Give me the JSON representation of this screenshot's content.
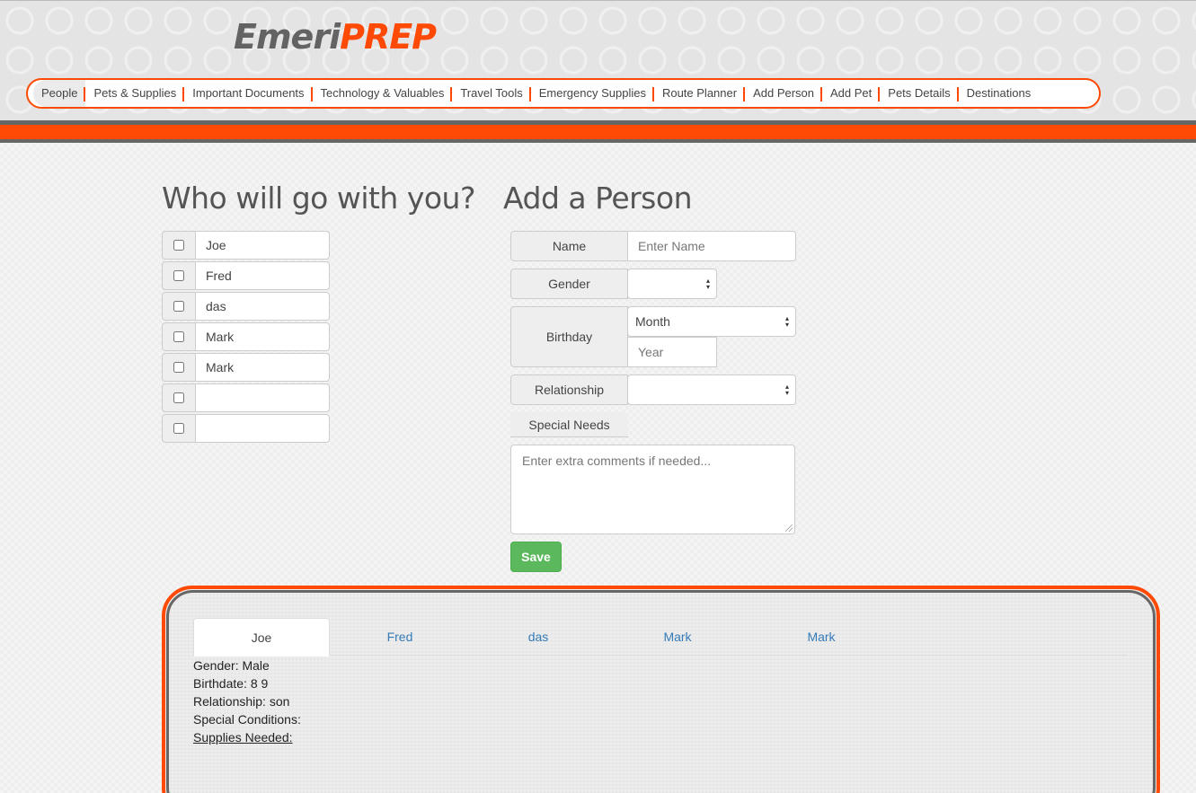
{
  "header": {
    "logo_part1": "Emeri",
    "logo_part2": "PREP",
    "nav": [
      "People",
      "Pets & Supplies",
      "Important Documents",
      "Technology & Valuables",
      "Travel Tools",
      "Emergency Supplies",
      "Route Planner",
      "Add Person",
      "Add Pet",
      "Pets Details",
      "Destinations"
    ]
  },
  "who": {
    "title": "Who will go with you?",
    "people": [
      "Joe",
      "Fred",
      "das",
      "Mark",
      "Mark",
      "",
      ""
    ]
  },
  "add_person": {
    "title": "Add a Person",
    "name_label": "Name",
    "name_placeholder": "Enter Name",
    "gender_label": "Gender",
    "gender_value": "",
    "birthday_label": "Birthday",
    "month_value": "Month",
    "year_placeholder": "Year",
    "relationship_label": "Relationship",
    "relationship_value": "",
    "special_needs_label": "Special Needs",
    "comments_placeholder": "Enter extra comments if needed...",
    "save_label": "Save"
  },
  "details_panel": {
    "tabs": [
      "Joe",
      "Fred",
      "das",
      "Mark",
      "Mark"
    ],
    "active_tab": "Joe",
    "gender": "Gender: Male",
    "birthdate": "Birthdate: 8 9",
    "relationship": "Relationship: son",
    "special_conditions": "Special Conditions:",
    "supplies_needed": "Supplies Needed:"
  },
  "colors": {
    "accent": "#ff4a06",
    "dark_gray": "#666666",
    "save_green": "#5cb85c",
    "link_blue": "#337ab7"
  }
}
